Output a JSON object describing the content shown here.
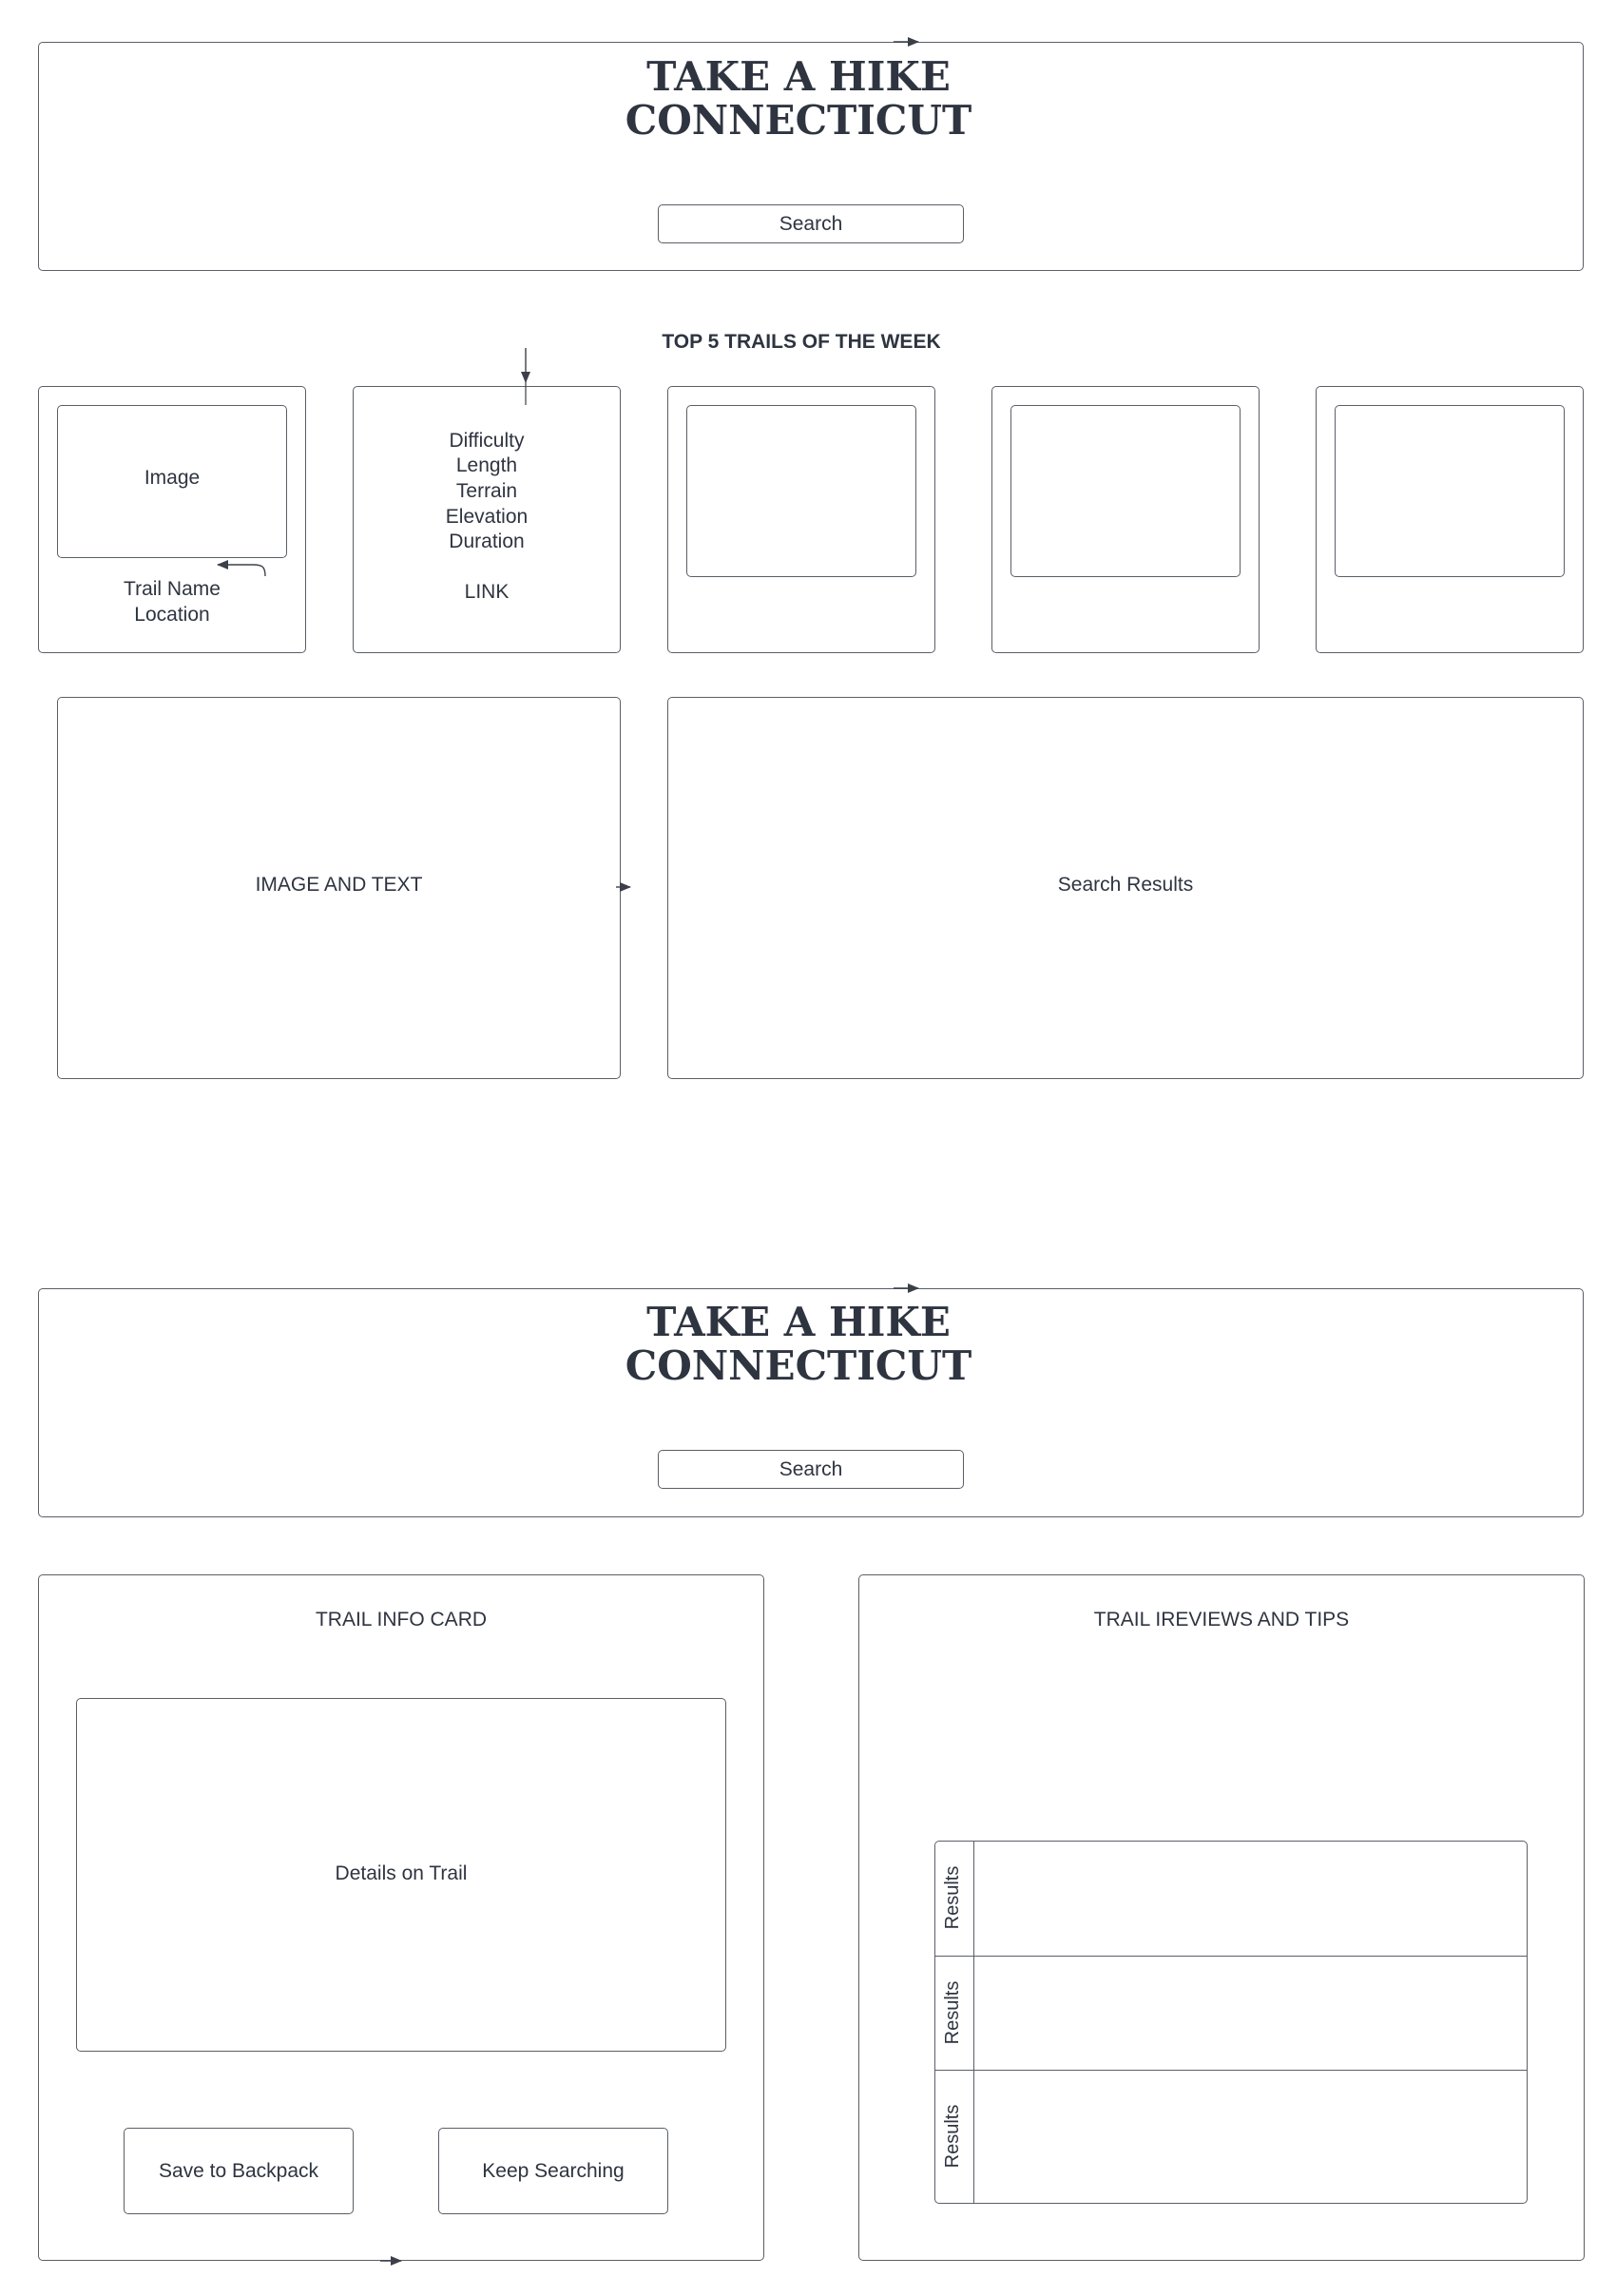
{
  "wireframe_1": {
    "header": {
      "title_line1": "TAKE A HIKE",
      "title_line2": "CONNECTICUT",
      "search_label": "Search"
    },
    "section_heading": "TOP 5 TRAILS OF THE WEEK",
    "card_1": {
      "image_label": "Image",
      "name_label": "Trail Name",
      "location_label": "Location"
    },
    "card_2": {
      "details": [
        "Difficulty",
        "Length",
        "Terrain",
        "Elevation",
        "Duration"
      ],
      "link_label": "LINK"
    },
    "image_and_text_label": "IMAGE AND TEXT",
    "search_results_label": "Search Results"
  },
  "wireframe_2": {
    "header": {
      "title_line1": "TAKE A HIKE",
      "title_line2": "CONNECTICUT",
      "search_label": "Search"
    },
    "trail_info": {
      "title": "TRAIL INFO CARD",
      "details_label": "Details on Trail",
      "save_button": "Save to Backpack",
      "keep_searching_button": "Keep Searching"
    },
    "reviews": {
      "title": "TRAIL IREVIEWS AND TIPS",
      "rows": [
        {
          "label": "Results"
        },
        {
          "label": "Results"
        },
        {
          "label": "Results"
        }
      ]
    }
  },
  "colors": {
    "stroke": "#5a5f66",
    "text": "#2e3440",
    "background": "#ffffff"
  }
}
